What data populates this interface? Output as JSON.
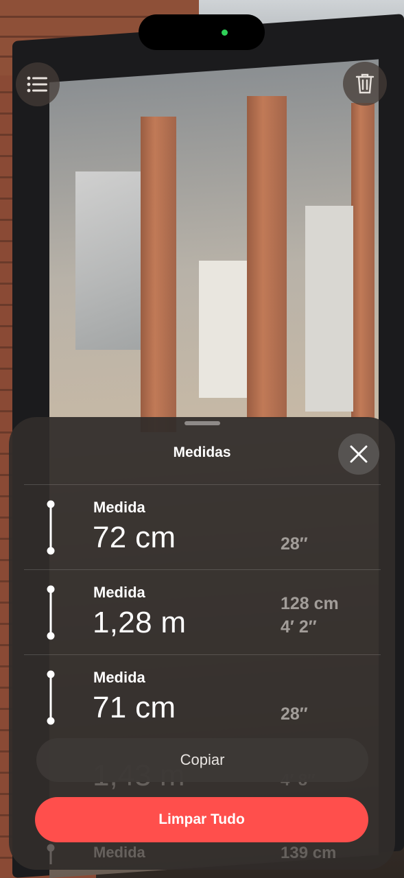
{
  "top_controls": {
    "list_icon": "list-icon",
    "trash_icon": "trash-icon",
    "camera_indicator_color": "#2fd158"
  },
  "sheet": {
    "title": "Medidas",
    "close_icon": "close-icon",
    "measurements": [
      {
        "label": "Medida",
        "value": "72 cm",
        "alt_lines": [
          "28″"
        ]
      },
      {
        "label": "Medida",
        "value": "1,28 m",
        "alt_lines": [
          "128 cm",
          "4′ 2″"
        ]
      },
      {
        "label": "Medida",
        "value": "71 cm",
        "alt_lines": [
          "28″"
        ]
      }
    ],
    "partial_rows": {
      "value": "1,43 m",
      "alt": "4′ 8″",
      "label": "Medida",
      "alt2": "139 cm"
    },
    "copy_label": "Copiar",
    "clear_label": "Limpar Tudo",
    "clear_color": "#ff4f4c"
  }
}
